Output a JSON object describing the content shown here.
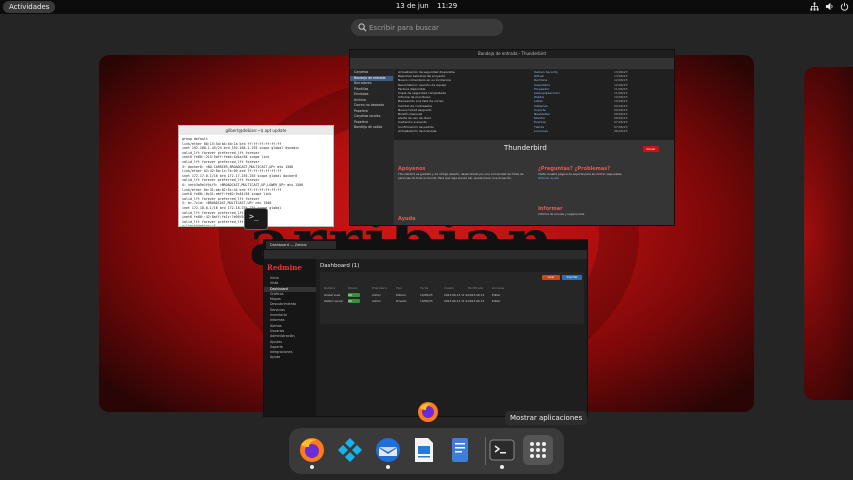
{
  "topbar": {
    "activities_label": "Actividades",
    "date": "13 de jun",
    "time": "11:29"
  },
  "search": {
    "placeholder": "Escribir para buscar"
  },
  "workspace": {
    "wallpaper_text": "arribian"
  },
  "windows": {
    "terminal": {
      "title": "gilbert@debian:~$ apt update",
      "lines": [
        "group default",
        "  link/ether 00:15:5d:b4:4d:1a brd ff:ff:ff:ff:ff:ff",
        "  inet 192.168.1.45/24 brd 192.168.1.255 scope global dynamic",
        "     valid_lft forever preferred_lft forever",
        "  inet6 fe80::215:5dff:feb4:4d1a/64 scope link",
        "     valid_lft forever preferred_lft forever",
        "3: docker0: <NO-CARRIER,BROADCAST,MULTICAST,UP> mtu 1500",
        "  link/ether 02:42:8a:1c:7e:09 brd ff:ff:ff:ff:ff:ff",
        "  inet 172.17.0.1/16 brd 172.17.255.255 scope global docker0",
        "     valid_lft forever preferred_lft forever",
        "4: veth3a9e1f@if5: <BROADCAST,MULTICAST,UP,LOWER_UP> mtu 1500",
        "  link/ether 6e:31:ab:02:9c:44 brd ff:ff:ff:ff:ff:ff",
        "  inet6 fe80::6c31:abff:fe02:9c44/64 scope link",
        "     valid_lft forever preferred_lft forever",
        "5: br-7c1d: <BROADCAST,MULTICAST,UP> mtu 1500",
        "  inet 172.18.0.1/16 brd 172.18.255.255 scope global",
        "     valid_lft forever preferred_lft forever",
        "  inet6 fe80::42:8aff:fe1c:7e09/64 scope link",
        "     valid_lft forever preferred_lft forever",
        "gilbert@debian:~$"
      ]
    },
    "thunderbird": {
      "title": "Bandeja de entrada - Thunderbird",
      "folders": [
        "Carpetas",
        "Bandeja de entrada",
        "Borradores",
        "Plantillas",
        "Enviados",
        "Archivo",
        "Correo no deseado",
        "Papelera",
        "Carpetas locales",
        "Papelera",
        "Bandeja de salida"
      ],
      "messages": [
        {
          "subject": "Actualización de seguridad disponible",
          "from": "Debian Security",
          "date": "13/06/23"
        },
        {
          "subject": "Resumen semanal del proyecto",
          "from": "GitLab",
          "date": "13/06/23"
        },
        {
          "subject": "Nuevo comentario en su incidencia",
          "from": "Redmine",
          "date": "12/06/23"
        },
        {
          "subject": "Recordatorio: reunión de equipo",
          "from": "Calendario",
          "date": "12/06/23"
        },
        {
          "subject": "Factura disponible",
          "from": "Proveedor",
          "date": "11/06/23"
        },
        {
          "subject": "Copia de seguridad completada",
          "from": "backup@servidor",
          "date": "11/06/23"
        },
        {
          "subject": "Informe de monitoreo",
          "from": "Zabbix",
          "date": "10/06/23"
        },
        {
          "subject": "Bienvenido a la lista de correo",
          "from": "Listas",
          "date": "10/06/23"
        },
        {
          "subject": "Cambio de contraseña",
          "from": "Sistemas",
          "date": "09/06/23"
        },
        {
          "subject": "Nuevo ticket asignado",
          "from": "Soporte",
          "date": "09/06/23"
        },
        {
          "subject": "Boletín mensual",
          "from": "Newsletter",
          "date": "08/06/23"
        },
        {
          "subject": "Alerta de uso de disco",
          "from": "Monitor",
          "date": "08/06/23"
        },
        {
          "subject": "Invitación a evento",
          "from": "Eventos",
          "date": "07/06/23"
        },
        {
          "subject": "Confirmación de pedido",
          "from": "Tienda",
          "date": "07/06/23"
        },
        {
          "subject": "Actualización de licencias",
          "from": "Licencias",
          "date": "06/06/23"
        }
      ],
      "welcome_title": "Thunderbird",
      "donate_label": "Donar",
      "cards": {
        "support_heading": "Apóyenos",
        "support_text": "Thunderbird es gratuito y de código abierto, desarrollado por una comunidad de miles de personas de todo el mundo. Para que siga siendo así, puede hacer una donación.",
        "questions_heading": "¿Preguntas? ¿Problemas?",
        "questions_text": "Visite nuestra página de soporte para encontrar respuestas.",
        "questions_link": "Obtener ayuda",
        "help_heading": "Ayuda",
        "report_heading": "Informar",
        "report_text": "Informe de errores y sugerencias."
      }
    },
    "firefox": {
      "tab_title": "Dashboard — Zabbix",
      "logo": "Redmine",
      "nav": [
        "Inicio",
        "Vista",
        "Dashboard",
        "Gráficos",
        "Mapas",
        "Descubrimiento",
        "Servicios",
        "Inventario",
        "Informes",
        "Alertas",
        "Usuarios",
        "Administración",
        "Ajustes",
        "Soporte",
        "Integraciones",
        "Ayuda"
      ],
      "heading": "Dashboard (1)",
      "columns": [
        "Nombre",
        "Estado",
        "Propietario",
        "Tipo",
        "Fecha",
        "Creado",
        "Modificado",
        "Acciones"
      ],
      "rows": [
        {
          "name": "Global view",
          "status": "OK",
          "owner": "Admin",
          "type": "Público",
          "date": "13/06/23",
          "created": "2023-06-13 11:20",
          "modified": "2023-06-13",
          "actions": "Editar"
        },
        {
          "name": "Zabbix server",
          "status": "OK",
          "owner": "Admin",
          "type": "Privado",
          "date": "13/06/23",
          "created": "2023-06-13 11:21",
          "modified": "2023-06-13",
          "actions": "Editar"
        }
      ],
      "create_button": "Crear",
      "import_button": "Importar"
    }
  },
  "tooltip": "Mostrar aplicaciones",
  "dock": {
    "items": [
      "Firefox",
      "Kodi",
      "Thunderbird",
      "LibreOffice Writer",
      "Editor de texto",
      "Terminal",
      "Mostrar aplicaciones"
    ]
  },
  "colors": {
    "accent_red": "#d11717",
    "dock_bg": "#3a3a3a",
    "panel_bg": "#0c0c0c"
  }
}
